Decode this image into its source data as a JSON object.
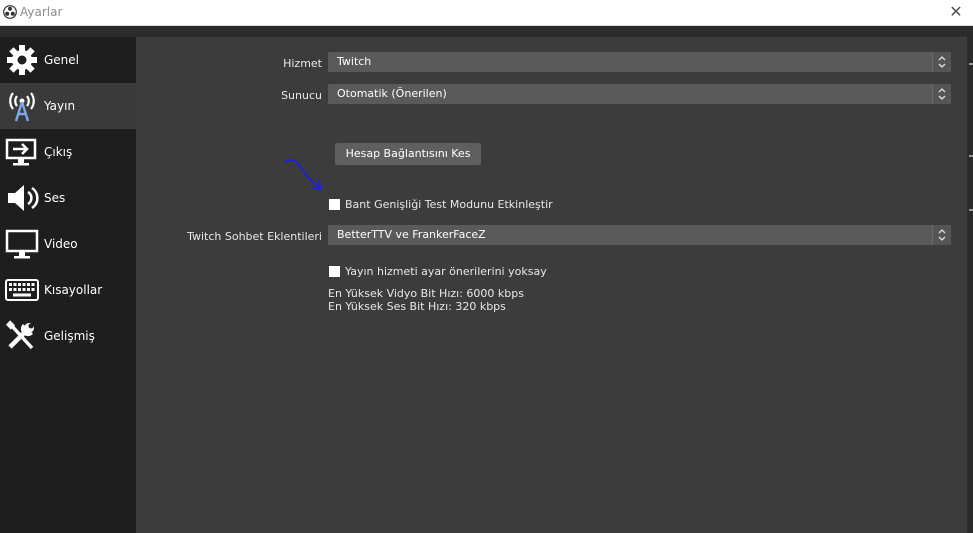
{
  "window": {
    "title": "Ayarlar",
    "close_glyph": "✕"
  },
  "sidebar": {
    "items": [
      {
        "label": "Genel",
        "icon": "gear-icon",
        "active": false
      },
      {
        "label": "Yayın",
        "icon": "broadcast-antenna-icon",
        "active": true
      },
      {
        "label": "Çıkış",
        "icon": "output-monitor-icon",
        "active": false
      },
      {
        "label": "Ses",
        "icon": "speaker-icon",
        "active": false
      },
      {
        "label": "Video",
        "icon": "monitor-icon",
        "active": false
      },
      {
        "label": "Kısayollar",
        "icon": "keyboard-icon",
        "active": false
      },
      {
        "label": "Gelişmiş",
        "icon": "tools-icon",
        "active": false
      }
    ]
  },
  "stream": {
    "service": {
      "label": "Hizmet",
      "value": "Twitch"
    },
    "server": {
      "label": "Sunucu",
      "value": "Otomatik (Önerilen)"
    },
    "disconnect_button": "Hesap Bağlantısını Kes",
    "bandwidth_test": {
      "label": "Bant Genişliği Test Modunu Etkinleştir",
      "checked": false
    },
    "chat_addons": {
      "label": "Twitch Sohbet Eklentileri",
      "value": "BetterTTV ve FrankerFaceZ"
    },
    "ignore_recommendations": {
      "label": "Yayın hizmeti ayar önerilerini yoksay",
      "checked": false
    },
    "max_video_bitrate": "En Yüksek Vidyo Bit Hızı: 6000 kbps",
    "max_audio_bitrate": "En Yüksek Ses Bit Hızı: 320 kbps"
  },
  "colors": {
    "sidebar_bg": "#1e1e1e",
    "panel_bg": "#3c3c3c",
    "annotation_arrow": "#1a1aff"
  }
}
